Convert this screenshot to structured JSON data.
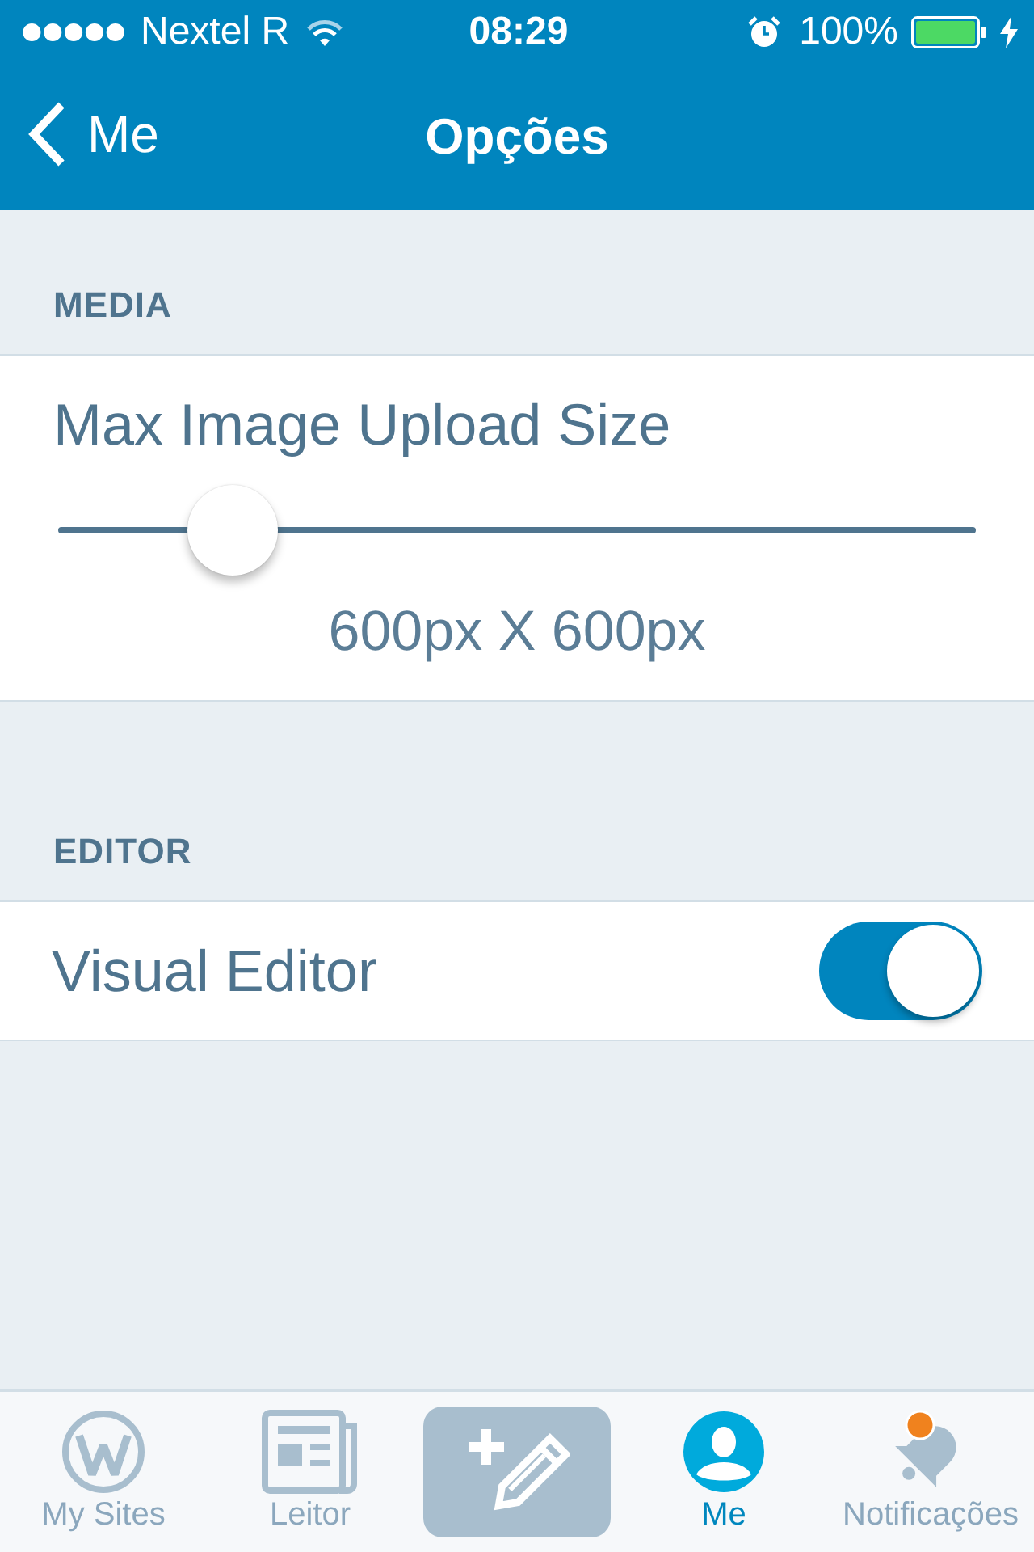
{
  "status_bar": {
    "carrier": "Nextel R",
    "time": "08:29",
    "battery": "100%"
  },
  "nav_bar": {
    "back_label": "Me",
    "title": "Opções"
  },
  "sections": [
    {
      "title": "MEDIA",
      "rows": [
        {
          "kind": "slider",
          "label": "Max Image Upload Size",
          "level": 0.19,
          "reading": "600px X 600px"
        }
      ]
    },
    {
      "title": "EDITOR",
      "rows": [
        {
          "kind": "switch",
          "label": "Visual Editor",
          "on": true
        }
      ]
    }
  ],
  "tab_bar": {
    "items": [
      {
        "kind": "sites",
        "label": "My Sites",
        "selected": false,
        "badge": false
      },
      {
        "kind": "reader",
        "label": "Leitor",
        "selected": false,
        "badge": false
      },
      {
        "kind": "compose",
        "selected": false
      },
      {
        "kind": "me",
        "label": "Me",
        "selected": true,
        "badge": false
      },
      {
        "kind": "notifications",
        "label": "Notificações",
        "selected": false,
        "badge": true
      }
    ]
  }
}
